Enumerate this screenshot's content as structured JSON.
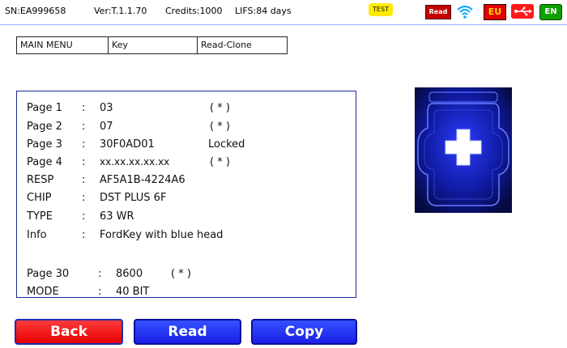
{
  "status": {
    "serial": "SN:EA999658",
    "version": "Ver:T.1.1.70",
    "credits": "Credits:1000",
    "life": "LIFS:84 days",
    "test_badge": "TEST",
    "read_badge": "Read",
    "region_badge": "EU",
    "language_badge": "EN",
    "icons": [
      "wifi-icon",
      "usb-icon"
    ]
  },
  "breadcrumb": {
    "items": [
      "MAIN MENU",
      "Key",
      "Read-Clone"
    ]
  },
  "info": {
    "rows": [
      {
        "label": "Page 1",
        "sep": ":",
        "value": "03",
        "note": "( * )"
      },
      {
        "label": "Page 2",
        "sep": ":",
        "value": "07",
        "note": "( * )"
      },
      {
        "label": "Page 3",
        "sep": ":",
        "value": "30F0AD01",
        "note": "Locked"
      },
      {
        "label": "Page 4",
        "sep": ":",
        "value": "xx.xx.xx.xx.xx",
        "note": "( * )"
      },
      {
        "label": "RESP",
        "sep": ":",
        "value": "AF5A1B-4224A6",
        "note": ""
      },
      {
        "label": "CHIP",
        "sep": ":",
        "value": "DST PLUS 6F",
        "note": ""
      },
      {
        "label": "TYPE",
        "sep": ":",
        "value": "63 WR",
        "note": ""
      },
      {
        "label": "Info",
        "sep": ":",
        "value": "FordKey with blue head",
        "note": ""
      },
      {
        "label": "Page 30",
        "sep": ":",
        "value": "8600",
        "note": "( * )"
      },
      {
        "label": "MODE",
        "sep": ":",
        "value": "40 BIT",
        "note": ""
      }
    ]
  },
  "buttons": {
    "back": "Back",
    "read": "Read",
    "copy": "Copy"
  },
  "colors": {
    "back": "#e50000",
    "action": "#1a1fe6",
    "panel_border": "#1d2a9a"
  }
}
